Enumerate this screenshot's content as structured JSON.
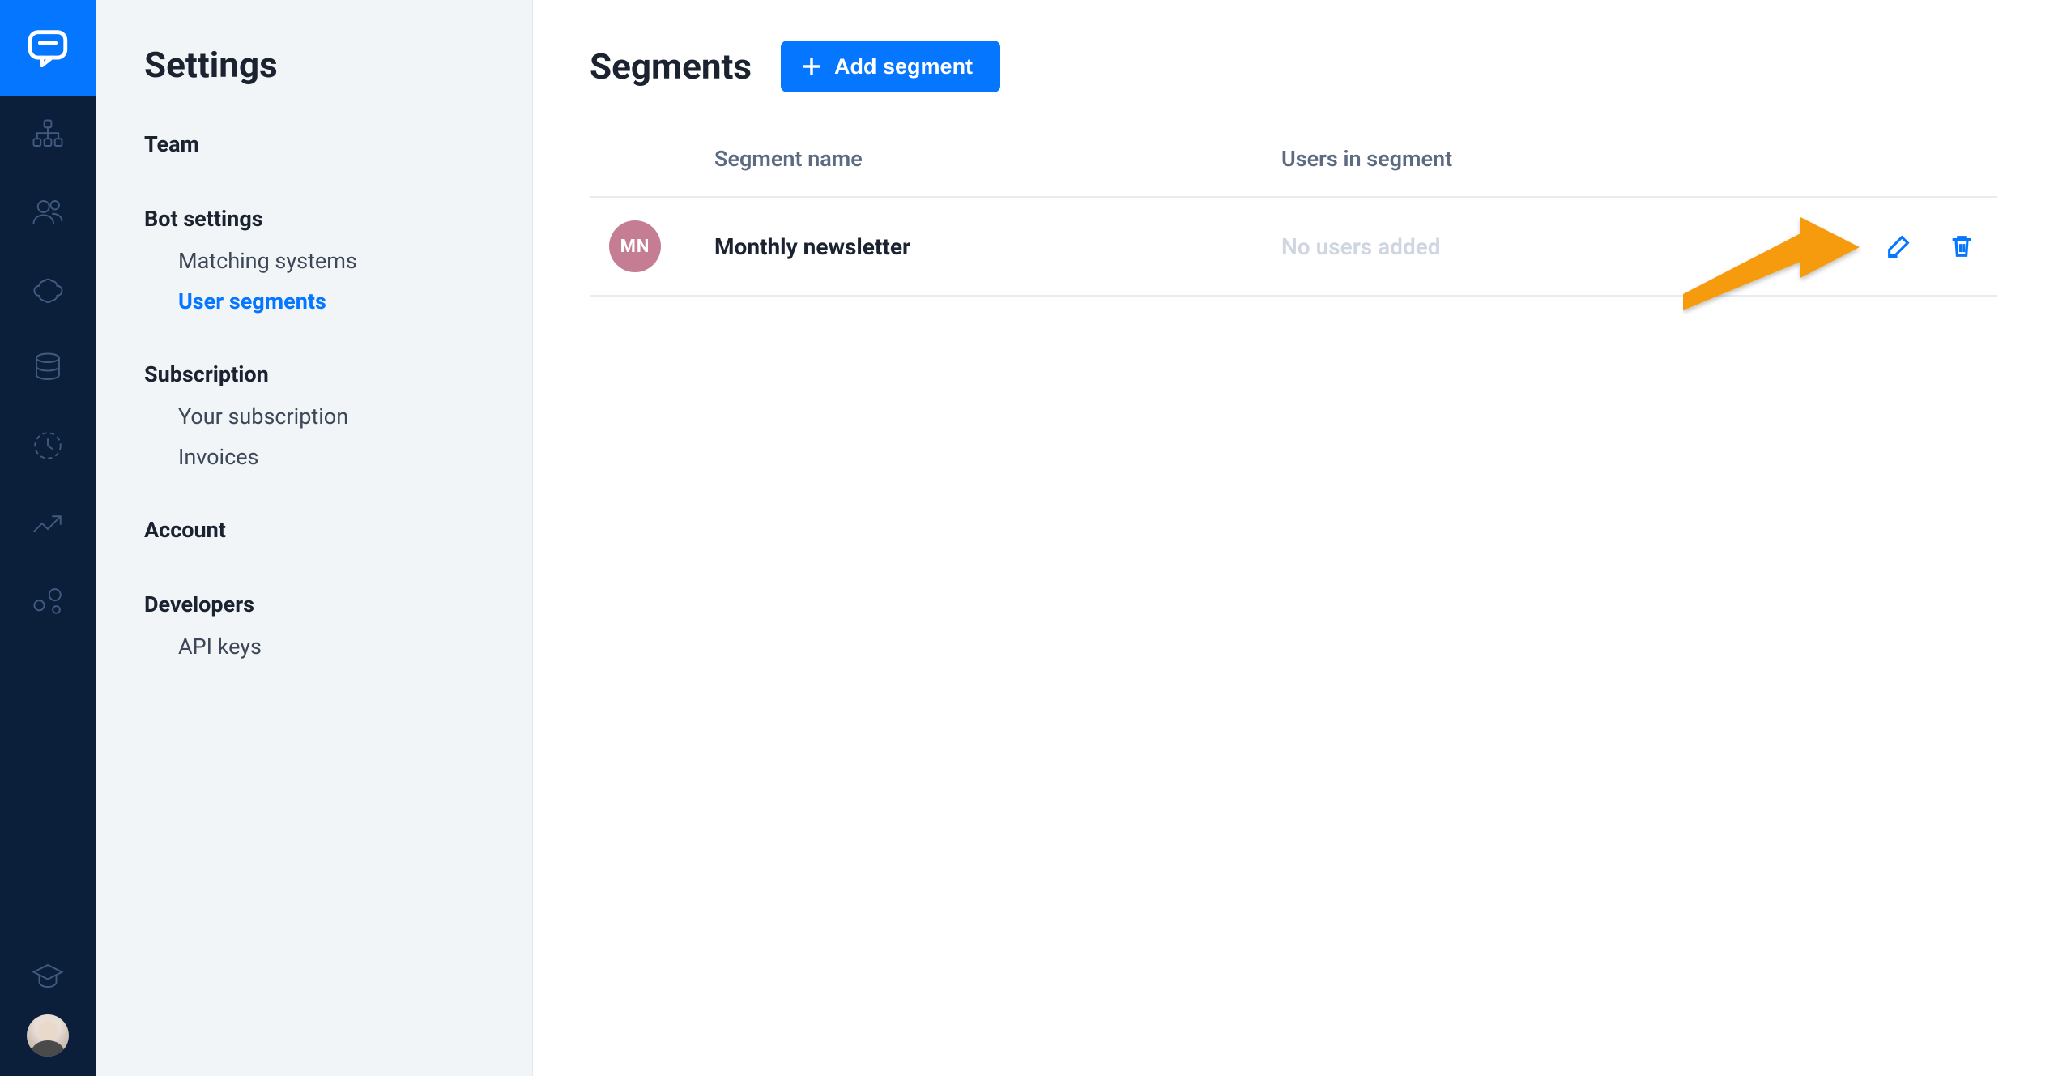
{
  "sidebar": {
    "title": "Settings",
    "sections": [
      {
        "label": "Team",
        "items": []
      },
      {
        "label": "Bot settings",
        "items": [
          {
            "label": "Matching systems",
            "active": false
          },
          {
            "label": "User segments",
            "active": true
          }
        ]
      },
      {
        "label": "Subscription",
        "items": [
          {
            "label": "Your subscription",
            "active": false
          },
          {
            "label": "Invoices",
            "active": false
          }
        ]
      },
      {
        "label": "Account",
        "items": []
      },
      {
        "label": "Developers",
        "items": [
          {
            "label": "API keys",
            "active": false
          }
        ]
      }
    ]
  },
  "main": {
    "title": "Segments",
    "add_button_label": "Add segment",
    "columns": {
      "name": "Segment name",
      "users": "Users in segment"
    },
    "rows": [
      {
        "badge": "MN",
        "name": "Monthly newsletter",
        "users_text": "No users added"
      }
    ]
  },
  "colors": {
    "brand": "#0576ff",
    "rail_bg": "#0b1f3a",
    "sidebar_bg": "#f2f5f8",
    "muted": "#5d6b82",
    "placeholder": "#cfd6e0",
    "badge_bg": "#c57d93",
    "annotation": "#f59b0a"
  }
}
